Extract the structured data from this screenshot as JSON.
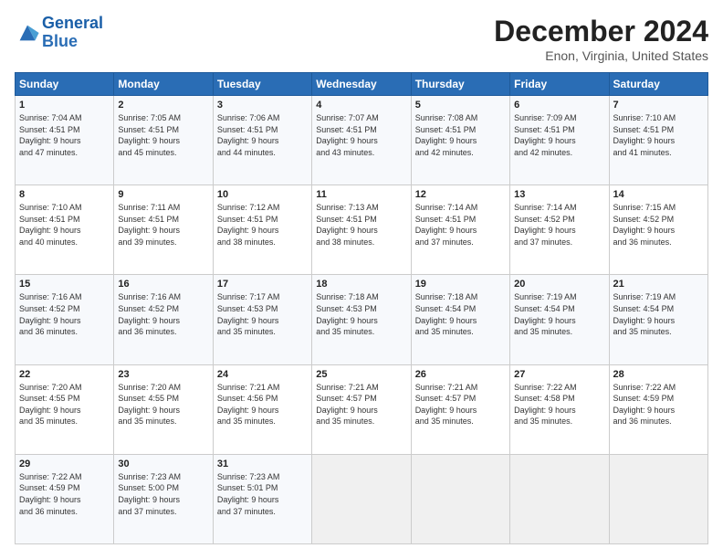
{
  "header": {
    "logo_line1": "General",
    "logo_line2": "Blue",
    "month_title": "December 2024",
    "location": "Enon, Virginia, United States"
  },
  "weekdays": [
    "Sunday",
    "Monday",
    "Tuesday",
    "Wednesday",
    "Thursday",
    "Friday",
    "Saturday"
  ],
  "weeks": [
    [
      {
        "day": "1",
        "info": "Sunrise: 7:04 AM\nSunset: 4:51 PM\nDaylight: 9 hours\nand 47 minutes."
      },
      {
        "day": "2",
        "info": "Sunrise: 7:05 AM\nSunset: 4:51 PM\nDaylight: 9 hours\nand 45 minutes."
      },
      {
        "day": "3",
        "info": "Sunrise: 7:06 AM\nSunset: 4:51 PM\nDaylight: 9 hours\nand 44 minutes."
      },
      {
        "day": "4",
        "info": "Sunrise: 7:07 AM\nSunset: 4:51 PM\nDaylight: 9 hours\nand 43 minutes."
      },
      {
        "day": "5",
        "info": "Sunrise: 7:08 AM\nSunset: 4:51 PM\nDaylight: 9 hours\nand 42 minutes."
      },
      {
        "day": "6",
        "info": "Sunrise: 7:09 AM\nSunset: 4:51 PM\nDaylight: 9 hours\nand 42 minutes."
      },
      {
        "day": "7",
        "info": "Sunrise: 7:10 AM\nSunset: 4:51 PM\nDaylight: 9 hours\nand 41 minutes."
      }
    ],
    [
      {
        "day": "8",
        "info": "Sunrise: 7:10 AM\nSunset: 4:51 PM\nDaylight: 9 hours\nand 40 minutes."
      },
      {
        "day": "9",
        "info": "Sunrise: 7:11 AM\nSunset: 4:51 PM\nDaylight: 9 hours\nand 39 minutes."
      },
      {
        "day": "10",
        "info": "Sunrise: 7:12 AM\nSunset: 4:51 PM\nDaylight: 9 hours\nand 38 minutes."
      },
      {
        "day": "11",
        "info": "Sunrise: 7:13 AM\nSunset: 4:51 PM\nDaylight: 9 hours\nand 38 minutes."
      },
      {
        "day": "12",
        "info": "Sunrise: 7:14 AM\nSunset: 4:51 PM\nDaylight: 9 hours\nand 37 minutes."
      },
      {
        "day": "13",
        "info": "Sunrise: 7:14 AM\nSunset: 4:52 PM\nDaylight: 9 hours\nand 37 minutes."
      },
      {
        "day": "14",
        "info": "Sunrise: 7:15 AM\nSunset: 4:52 PM\nDaylight: 9 hours\nand 36 minutes."
      }
    ],
    [
      {
        "day": "15",
        "info": "Sunrise: 7:16 AM\nSunset: 4:52 PM\nDaylight: 9 hours\nand 36 minutes."
      },
      {
        "day": "16",
        "info": "Sunrise: 7:16 AM\nSunset: 4:52 PM\nDaylight: 9 hours\nand 36 minutes."
      },
      {
        "day": "17",
        "info": "Sunrise: 7:17 AM\nSunset: 4:53 PM\nDaylight: 9 hours\nand 35 minutes."
      },
      {
        "day": "18",
        "info": "Sunrise: 7:18 AM\nSunset: 4:53 PM\nDaylight: 9 hours\nand 35 minutes."
      },
      {
        "day": "19",
        "info": "Sunrise: 7:18 AM\nSunset: 4:54 PM\nDaylight: 9 hours\nand 35 minutes."
      },
      {
        "day": "20",
        "info": "Sunrise: 7:19 AM\nSunset: 4:54 PM\nDaylight: 9 hours\nand 35 minutes."
      },
      {
        "day": "21",
        "info": "Sunrise: 7:19 AM\nSunset: 4:54 PM\nDaylight: 9 hours\nand 35 minutes."
      }
    ],
    [
      {
        "day": "22",
        "info": "Sunrise: 7:20 AM\nSunset: 4:55 PM\nDaylight: 9 hours\nand 35 minutes."
      },
      {
        "day": "23",
        "info": "Sunrise: 7:20 AM\nSunset: 4:55 PM\nDaylight: 9 hours\nand 35 minutes."
      },
      {
        "day": "24",
        "info": "Sunrise: 7:21 AM\nSunset: 4:56 PM\nDaylight: 9 hours\nand 35 minutes."
      },
      {
        "day": "25",
        "info": "Sunrise: 7:21 AM\nSunset: 4:57 PM\nDaylight: 9 hours\nand 35 minutes."
      },
      {
        "day": "26",
        "info": "Sunrise: 7:21 AM\nSunset: 4:57 PM\nDaylight: 9 hours\nand 35 minutes."
      },
      {
        "day": "27",
        "info": "Sunrise: 7:22 AM\nSunset: 4:58 PM\nDaylight: 9 hours\nand 35 minutes."
      },
      {
        "day": "28",
        "info": "Sunrise: 7:22 AM\nSunset: 4:59 PM\nDaylight: 9 hours\nand 36 minutes."
      }
    ],
    [
      {
        "day": "29",
        "info": "Sunrise: 7:22 AM\nSunset: 4:59 PM\nDaylight: 9 hours\nand 36 minutes."
      },
      {
        "day": "30",
        "info": "Sunrise: 7:23 AM\nSunset: 5:00 PM\nDaylight: 9 hours\nand 37 minutes."
      },
      {
        "day": "31",
        "info": "Sunrise: 7:23 AM\nSunset: 5:01 PM\nDaylight: 9 hours\nand 37 minutes."
      },
      {
        "day": "",
        "info": ""
      },
      {
        "day": "",
        "info": ""
      },
      {
        "day": "",
        "info": ""
      },
      {
        "day": "",
        "info": ""
      }
    ]
  ]
}
